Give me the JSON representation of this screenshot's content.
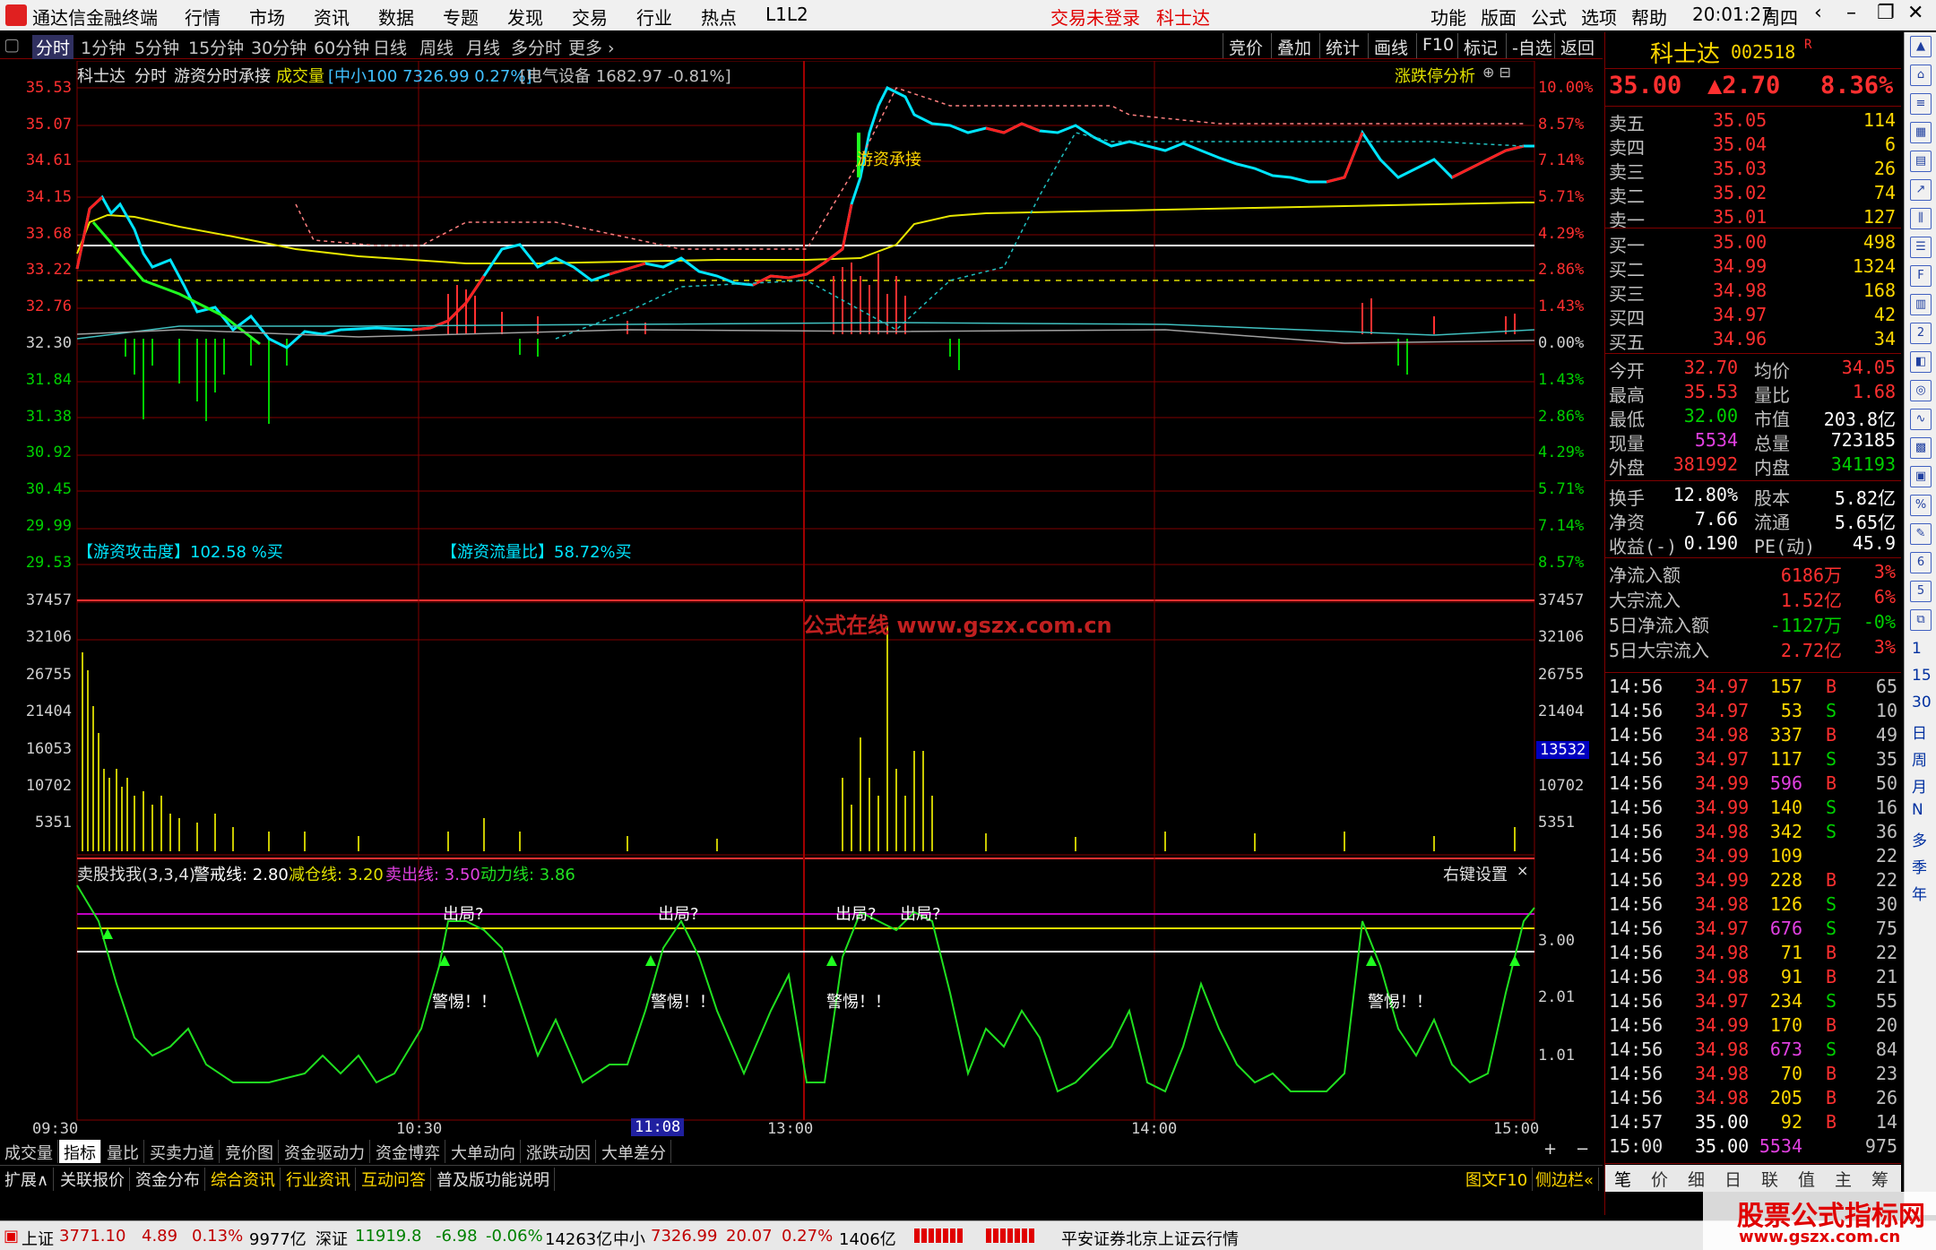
{
  "titlebar": {
    "app": "通达信金融终端",
    "menus": [
      "行情",
      "市场",
      "资讯",
      "数据",
      "专题",
      "发现",
      "交易",
      "行业",
      "热点",
      "L1L2"
    ],
    "login": "交易未登录",
    "stock": "科士达",
    "right_menus": [
      "功能",
      "版面",
      "公式",
      "选项",
      "帮助"
    ],
    "time": "20:01:27",
    "weekday": "周四"
  },
  "toolbar": {
    "periods": [
      "分时",
      "1分钟",
      "5分钟",
      "15分钟",
      "30分钟",
      "60分钟",
      "日线",
      "周线",
      "月线",
      "多分时",
      "更多 ›"
    ],
    "right": [
      "竞价",
      "叠加",
      "统计",
      "画线",
      "F10",
      "标记",
      "-自选",
      "返回"
    ]
  },
  "chart": {
    "header_name": "科士达",
    "header_mode": "分时",
    "header_formula": "游资分时承接",
    "header_vol": "成交量",
    "header_index": "[中小100 7326.99 0.27%]",
    "header_sector": "[电气设备 1682.97 -0.81%]",
    "header_right": "涨跌停分析",
    "annotation": "游资承接",
    "attack_label": "【游资攻击度】102.58 %买",
    "flow_label": "【游资流量比】58.72%买",
    "watermark": "公式在线  www.gszx.com.cn",
    "price_axis": [
      "35.53",
      "35.07",
      "34.61",
      "34.15",
      "33.68",
      "33.22",
      "32.76",
      "32.30",
      "31.84",
      "31.38",
      "30.92",
      "30.45",
      "29.99",
      "29.53"
    ],
    "pct_axis": [
      "10.00%",
      "8.57%",
      "7.14%",
      "5.71%",
      "4.29%",
      "2.86%",
      "1.43%",
      "0.00%",
      "1.43%",
      "2.86%",
      "4.29%",
      "5.71%",
      "7.14%",
      "8.57%"
    ],
    "vol_axis": [
      "37457",
      "32106",
      "26755",
      "21404",
      "16053",
      "10702",
      "5351"
    ],
    "vol_marker": "13532",
    "ind_header": "卖股找我(3,3,4)",
    "ind_alert": "警戒线: 2.80",
    "ind_reduce": "减仓线: 3.20",
    "ind_sell": "卖出线: 3.50",
    "ind_power": "动力线: 3.86",
    "ind_right": "右键设置",
    "ind_axis": [
      "3.00",
      "2.01",
      "1.01"
    ],
    "time_axis": [
      "09:30",
      "10:30",
      "11:08",
      "13:00",
      "14:00",
      "15:00"
    ],
    "sig_out": "出局?",
    "sig_warn": "警惕！！"
  },
  "tabs1": [
    "成交量",
    "指标",
    "量比",
    "买卖力道",
    "竞价图",
    "资金驱动力",
    "资金博弈",
    "大单动向",
    "涨跌动因",
    "大单差分"
  ],
  "tabs2": [
    "扩展∧",
    "关联报价",
    "资金分布",
    "综合资讯",
    "行业资讯",
    "互动问答",
    "普及版功能说明"
  ],
  "tabs2_right": [
    "图文F10",
    "侧边栏«"
  ],
  "quote": {
    "name": "科士达",
    "code": "002518",
    "flag": "R",
    "price": "35.00",
    "change": "▲2.70",
    "pct": "8.36%",
    "asks": [
      [
        "卖五",
        "35.05",
        "114"
      ],
      [
        "卖四",
        "35.04",
        "6"
      ],
      [
        "卖三",
        "35.03",
        "26"
      ],
      [
        "卖二",
        "35.02",
        "74"
      ],
      [
        "卖一",
        "35.01",
        "127"
      ]
    ],
    "bids": [
      [
        "买一",
        "35.00",
        "498"
      ],
      [
        "买二",
        "34.99",
        "1324"
      ],
      [
        "买三",
        "34.98",
        "168"
      ],
      [
        "买四",
        "34.97",
        "42"
      ],
      [
        "买五",
        "34.96",
        "34"
      ]
    ],
    "stats": [
      [
        "今开",
        "32.70",
        "均价",
        "34.05"
      ],
      [
        "最高",
        "35.53",
        "量比",
        "1.68"
      ],
      [
        "最低",
        "32.00",
        "市值",
        "203.8亿"
      ],
      [
        "现量",
        "5534",
        "总量",
        "723185"
      ],
      [
        "外盘",
        "381992",
        "内盘",
        "341193"
      ]
    ],
    "stats2": [
      [
        "换手",
        "12.80%",
        "股本",
        "5.82亿"
      ],
      [
        "净资",
        "7.66",
        "流通",
        "5.65亿"
      ],
      [
        "收益(-)",
        "0.190",
        "PE(动)",
        "45.9"
      ]
    ],
    "flows": [
      [
        "净流入额",
        "6186万",
        "3%"
      ],
      [
        "大宗流入",
        "1.52亿",
        "6%"
      ],
      [
        "5日净流入额",
        "-1127万",
        "-0%"
      ],
      [
        "5日大宗流入",
        "2.72亿",
        "3%"
      ]
    ],
    "ticks": [
      [
        "14:56",
        "34.97",
        "157",
        "B",
        "65"
      ],
      [
        "14:56",
        "34.97",
        "53",
        "S",
        "10"
      ],
      [
        "14:56",
        "34.98",
        "337",
        "B",
        "49"
      ],
      [
        "14:56",
        "34.97",
        "117",
        "S",
        "35"
      ],
      [
        "14:56",
        "34.99",
        "596",
        "B",
        "50"
      ],
      [
        "14:56",
        "34.99",
        "140",
        "S",
        "16"
      ],
      [
        "14:56",
        "34.98",
        "342",
        "S",
        "36"
      ],
      [
        "14:56",
        "34.99",
        "109",
        "",
        "22"
      ],
      [
        "14:56",
        "34.99",
        "228",
        "B",
        "22"
      ],
      [
        "14:56",
        "34.98",
        "126",
        "S",
        "30"
      ],
      [
        "14:56",
        "34.97",
        "676",
        "S",
        "75"
      ],
      [
        "14:56",
        "34.98",
        "71",
        "B",
        "22"
      ],
      [
        "14:56",
        "34.98",
        "91",
        "B",
        "21"
      ],
      [
        "14:56",
        "34.97",
        "234",
        "S",
        "55"
      ],
      [
        "14:56",
        "34.99",
        "170",
        "B",
        "20"
      ],
      [
        "14:56",
        "34.98",
        "673",
        "S",
        "84"
      ],
      [
        "14:56",
        "34.98",
        "70",
        "B",
        "23"
      ],
      [
        "14:56",
        "34.98",
        "205",
        "B",
        "26"
      ],
      [
        "14:57",
        "35.00",
        "92",
        "B",
        "14"
      ],
      [
        "15:00",
        "35.00",
        "5534",
        "",
        "975"
      ]
    ],
    "bottom_tabs": [
      "笔",
      "价",
      "细",
      "日",
      "联",
      "值",
      "主",
      "筹"
    ]
  },
  "statusbar": {
    "sh_name": "上证",
    "sh_val": "3771.10",
    "sh_chg": "4.89",
    "sh_pct": "0.13%",
    "sh_amt": "9977亿",
    "sz_name": "深证",
    "sz_val": "11919.8",
    "sz_chg": "-6.98",
    "sz_pct": "-0.06%",
    "sz_amt": "14263亿",
    "zx_name": "中小",
    "zx_val": "7326.99",
    "zx_chg": "20.07",
    "zx_pct": "0.27%",
    "zx_amt": "1406亿",
    "broker": "平安证券北京上证云行情"
  },
  "sidebar_chars": [
    "1",
    "15",
    "30",
    "日",
    "周",
    "月",
    "N",
    "多",
    "季",
    "年"
  ],
  "watermark2": {
    "line1": "股票公式指标网",
    "line2": "www.gszx.com.cn"
  },
  "colors": {
    "up": "#ff3030",
    "down": "#00d000",
    "grid": "#800000",
    "price": "#00e5ff",
    "avg": "#ffff00"
  }
}
